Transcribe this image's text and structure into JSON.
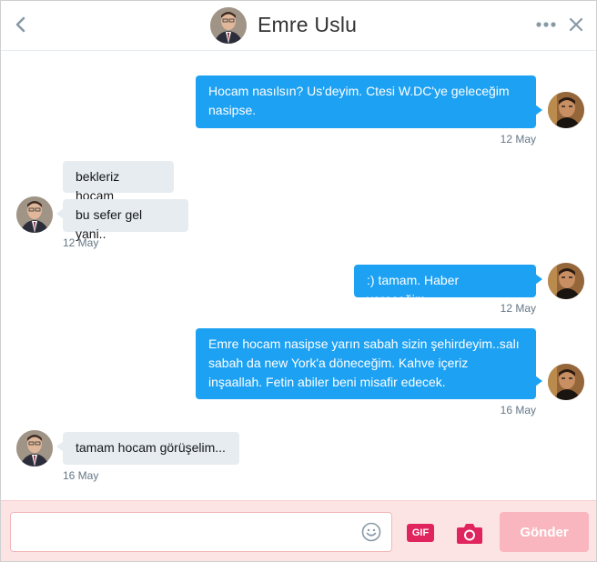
{
  "header": {
    "title": "Emre Uslu",
    "back_icon": "chevron-left-icon",
    "more_icon": "more-horizontal-icon",
    "close_icon": "close-icon"
  },
  "messages": [
    {
      "direction": "out",
      "lines": [
        "Hocam nasılsın? Us'deyim. Ctesi W.DC'ye geleceğim",
        "nasipse."
      ],
      "time": "12 May"
    },
    {
      "direction": "in",
      "lines": [
        "bekleriz hocam"
      ]
    },
    {
      "direction": "in",
      "lines": [
        "bu sefer gel yani.."
      ],
      "time": "12 May"
    },
    {
      "direction": "out",
      "lines": [
        ":) tamam. Haber vereceğim."
      ],
      "time": "12 May"
    },
    {
      "direction": "out",
      "lines": [
        "Emre hocam nasipse yarın sabah sizin şehirdeyim..salı",
        "sabah da new York'a döneceğim. Kahve içeriz",
        "inşaallah. Fetin abiler beni misafir edecek."
      ],
      "time": "16 May"
    },
    {
      "direction": "in",
      "lines": [
        "tamam hocam görüşelim..."
      ],
      "time": "16 May"
    }
  ],
  "composer": {
    "input_value": "",
    "input_placeholder": "",
    "gif_label": "GIF",
    "send_label": "Gönder"
  },
  "colors": {
    "outgoing_bubble": "#1da1f2",
    "incoming_bubble": "#e6ecf0",
    "composer_bg": "#fde4e4",
    "send_button": "#f9b6bf",
    "gif_button": "#e0245e"
  }
}
